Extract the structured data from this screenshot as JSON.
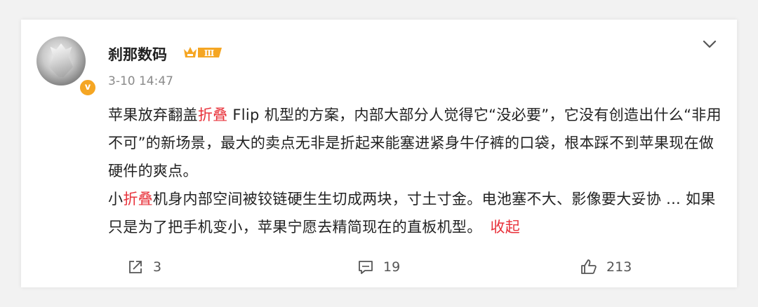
{
  "post": {
    "author": "刹那数码",
    "rank_badge": "Ⅲ",
    "verified_mark": "v",
    "time": "3-10 14:47",
    "content_segments": [
      {
        "text": "苹果放弃翻盖",
        "highlight": false
      },
      {
        "text": "折叠",
        "highlight": true
      },
      {
        "text": " Flip 机型的方案，内部大部分人觉得它“没必要”，它没有创造出什么“非用不可”的新场景，最大的卖点无非是折起来能塞进紧身牛仔裤的口袋，根本踩不到苹果现在做硬件的爽点。",
        "highlight": false
      }
    ],
    "content_segments2": [
      {
        "text": "小",
        "highlight": false
      },
      {
        "text": "折叠",
        "highlight": true
      },
      {
        "text": "机身内部空间被铰链硬生生切成两块，寸土寸金。电池塞不大、影像要大妥协 ... 如果只是为了把手机变小，苹果宁愿去精简现在的直板机型。",
        "highlight": false
      }
    ],
    "collapse_label": "收起"
  },
  "actions": {
    "share_count": "3",
    "comment_count": "19",
    "like_count": "213"
  },
  "colors": {
    "highlight": "#e8313a",
    "badge_gold": "#f5a623"
  }
}
